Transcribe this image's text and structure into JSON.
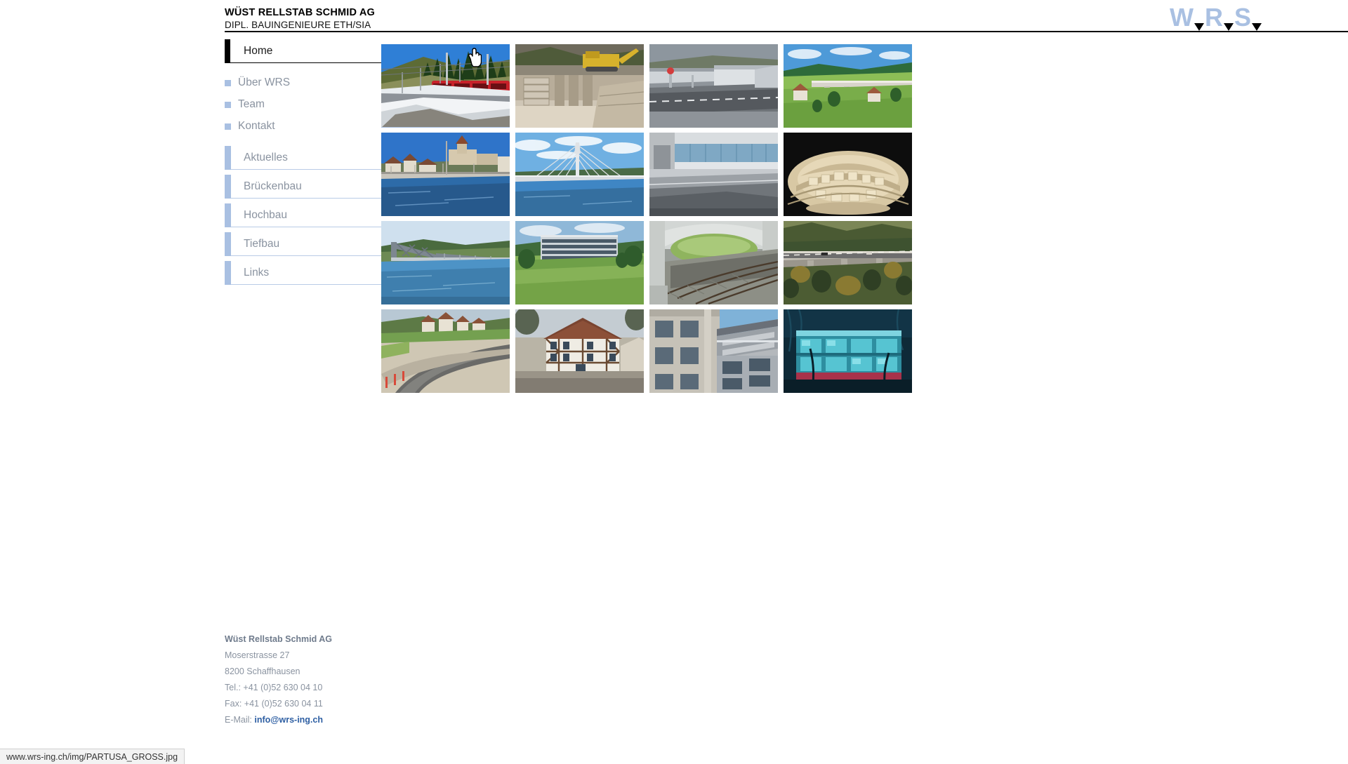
{
  "header": {
    "company_name": "WÜST RELLSTAB SCHMID AG",
    "company_subtitle": "DIPL. BAUINGENIEURE ETH/SIA",
    "logo_w": "W",
    "logo_r": "R",
    "logo_s": "S"
  },
  "sidebar": {
    "home": {
      "label": "Home"
    },
    "simple_items": [
      {
        "label": "Über WRS",
        "icon": "square-bullet"
      },
      {
        "label": "Team",
        "icon": "square-bullet"
      },
      {
        "label": "Kontakt",
        "icon": "square-bullet"
      }
    ],
    "sections": [
      {
        "label": "Aktuelles"
      },
      {
        "label": "Brückenbau"
      },
      {
        "label": "Hochbau"
      },
      {
        "label": "Tiefbau"
      },
      {
        "label": "Links"
      }
    ]
  },
  "gallery": {
    "hovered_index": 0,
    "items": [
      {
        "caption": "Rote Schmalspurbahn auf Brücke im Schnee"
      },
      {
        "caption": "Baustelle mit Bagger und Betonfundamenten"
      },
      {
        "caption": "Autobahnunterführung mit Betonbrücke"
      },
      {
        "caption": "Viadukt über grüne Wiesenlandschaft"
      },
      {
        "caption": "Stadtbrücke mit Burg Munot im Hintergrund"
      },
      {
        "caption": "Schrägseilbrücke über den Fluss"
      },
      {
        "caption": "Modernes Gebäude mit Glasfassade und Rampe"
      },
      {
        "caption": "Architekturmodell aus Holz"
      },
      {
        "caption": "Stahlfachwerk-Fussgängerbrücke über Wasser"
      },
      {
        "caption": "Bürogebäude mit Bandfassade auf Wiese"
      },
      {
        "caption": "Bahnunterführung mit Gleisen"
      },
      {
        "caption": "Autobahnviadukt im Herbstwald"
      },
      {
        "caption": "Strassenbau mit Dorf im Hintergrund"
      },
      {
        "caption": "Riegelhaus im Ortskern"
      },
      {
        "caption": "Wohnüberbauung mit Balkonen"
      },
      {
        "caption": "Glasgebäude bei Abenddämmerung"
      }
    ]
  },
  "footer": {
    "name": "Wüst Rellstab Schmid AG",
    "street": "Moserstrasse 27",
    "city": "8200 Schaffhausen",
    "tel": "Tel.: +41 (0)52 630 04 10",
    "fax": "Fax: +41 (0)52 630 04 11",
    "email_label": "E-Mail:",
    "email": "info@wrs-ing.ch"
  },
  "statusbar": {
    "url": "www.wrs-ing.ch/img/PARTUSA_GROSS.jpg"
  }
}
